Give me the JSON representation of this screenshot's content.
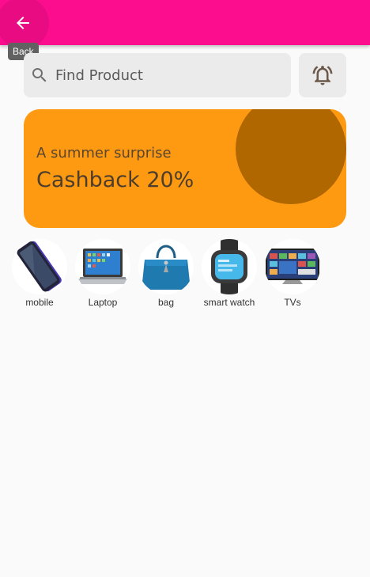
{
  "colors": {
    "app_bar": "#fc0d8e",
    "promo_background": "#fd9a12",
    "promo_circle": "#b06700",
    "field_background": "#ebebeb",
    "page_background": "#fafafa"
  },
  "app_bar": {
    "back_icon": "arrow-back-icon",
    "back_tooltip": "Back"
  },
  "search": {
    "icon": "search-icon",
    "placeholder": "Find Product",
    "value": ""
  },
  "notifications": {
    "icon": "notification-bell-icon"
  },
  "promo": {
    "subtitle": "A summer surprise",
    "title": "Cashback 20%"
  },
  "categories": [
    {
      "label": "mobile",
      "icon": "smartphone-image"
    },
    {
      "label": "Laptop",
      "icon": "laptop-image"
    },
    {
      "label": "bag",
      "icon": "handbag-image"
    },
    {
      "label": "smart watch",
      "icon": "smartwatch-image"
    },
    {
      "label": "TVs",
      "icon": "television-image"
    }
  ]
}
